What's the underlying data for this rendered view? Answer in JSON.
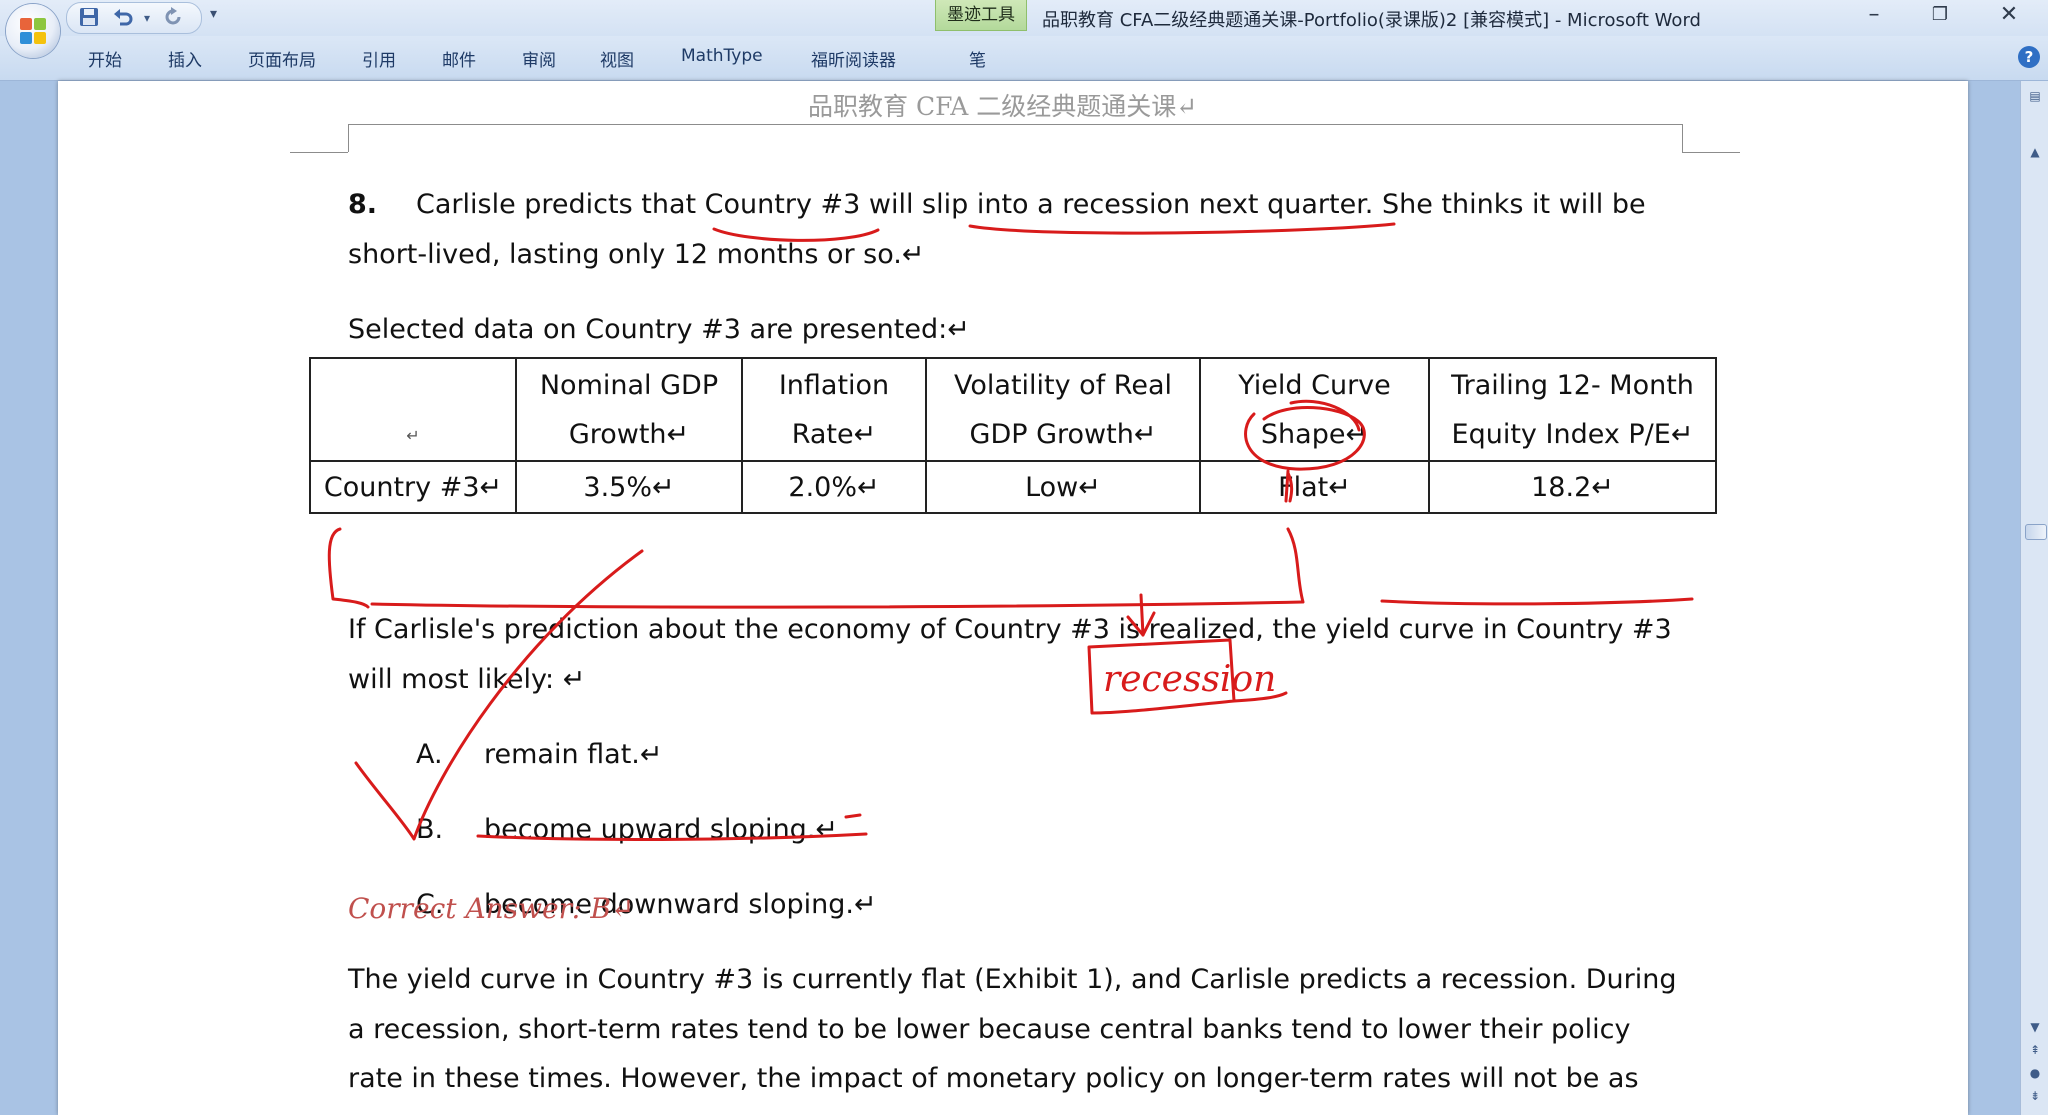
{
  "window": {
    "ink_tools_tab": "墨迹工具",
    "title": "品职教育 CFA二级经典题通关课-Portfolio(录课版)2 [兼容模式] - Microsoft Word",
    "minimize_glyph": "–",
    "restore_glyph": "❐",
    "close_glyph": "✕"
  },
  "quick_access": {
    "save_icon": "save-icon",
    "undo_icon": "undo-icon",
    "redo_icon": "redo-icon",
    "customize_glyph": "▾"
  },
  "ribbon": {
    "tabs": [
      "开始",
      "插入",
      "页面布局",
      "引用",
      "邮件",
      "审阅",
      "视图",
      "MathType",
      "福昕阅读器",
      "笔"
    ],
    "help_glyph": "?"
  },
  "page": {
    "header": "品职教育  CFA 二级经典题通关课↵",
    "question_number": "8.",
    "question_line1": "Carlisle predicts that Country #3 will slip into a recession next quarter. She thinks it will be",
    "question_line2": "short-lived, lasting only 12 months or so.↵",
    "table_intro": "Selected data on Country #3 are presented:↵",
    "table": {
      "headers_line1": [
        "",
        "Nominal GDP",
        "Inflation",
        "Volatility of Real",
        "Yield Curve",
        "Trailing 12- Month"
      ],
      "headers_line2": [
        "↵",
        "Growth↵",
        "Rate↵",
        "GDP Growth↵",
        "Shape↵",
        "Equity Index P/E↵"
      ],
      "row": [
        "Country #3↵",
        "3.5%↵",
        "2.0%↵",
        "Low↵",
        "Flat↵",
        "18.2↵"
      ]
    },
    "prompt_line1": "If Carlisle's prediction about the economy of Country #3 is realized, the yield curve in Country #3",
    "prompt_line2": "will most likely:  ↵",
    "options": [
      {
        "letter": "A.",
        "text": "remain flat.↵"
      },
      {
        "letter": "B.",
        "text": "become upward sloping.↵"
      },
      {
        "letter": "C.",
        "text": "become downward sloping.↵"
      }
    ],
    "correct_answer": "Correct Answer: B↵",
    "explanation": [
      "The yield curve in Country #3 is currently flat (Exhibit 1), and Carlisle predicts a recession. During",
      "a recession, short-term rates tend to be lower because central banks tend to lower their policy",
      "rate in these times. However, the impact of monetary policy on longer-term rates will not be as"
    ],
    "handwritten_note": "recession"
  },
  "colors": {
    "ink": "#d81b1b",
    "correct_answer": "#c0504d",
    "ink_tools_tab": "#b3d99b"
  }
}
